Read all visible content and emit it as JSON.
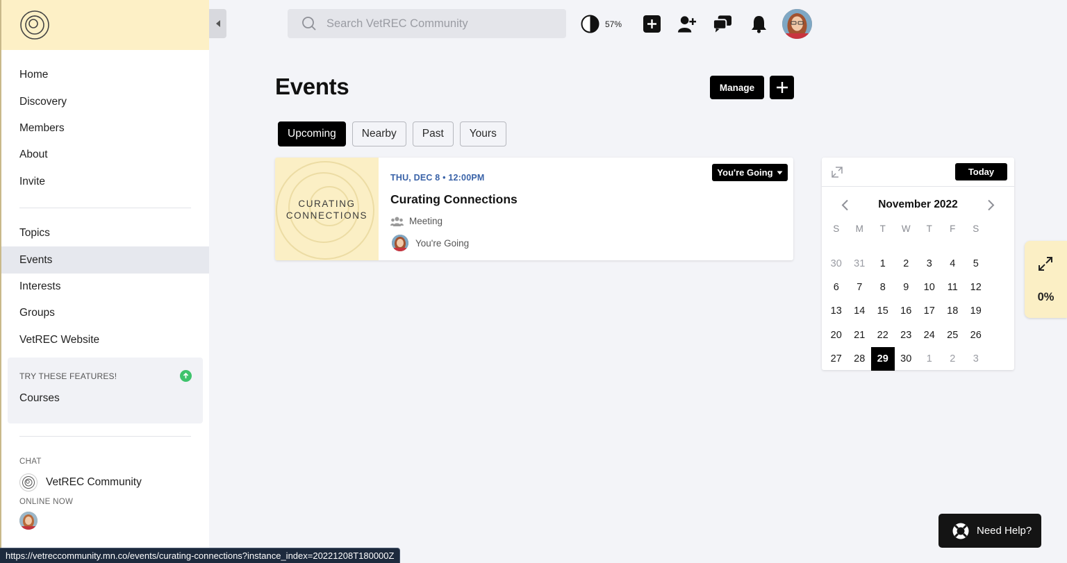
{
  "sidebar": {
    "nav_primary": [
      {
        "label": "Home"
      },
      {
        "label": "Discovery"
      },
      {
        "label": "Members"
      },
      {
        "label": "About"
      },
      {
        "label": "Invite"
      }
    ],
    "nav_secondary": [
      {
        "label": "Topics"
      },
      {
        "label": "Events",
        "active": true
      },
      {
        "label": "Interests"
      },
      {
        "label": "Groups"
      },
      {
        "label": "VetREC Website"
      }
    ],
    "features": {
      "title": "TRY THESE FEATURES!",
      "item": "Courses"
    },
    "chat_label": "CHAT",
    "chat_item": "VetREC Community",
    "online_label": "ONLINE NOW"
  },
  "topbar": {
    "search_placeholder": "Search VetREC Community",
    "contrast_pct": "57%"
  },
  "main": {
    "title": "Events",
    "manage_label": "Manage",
    "tabs": [
      {
        "label": "Upcoming",
        "active": true
      },
      {
        "label": "Nearby"
      },
      {
        "label": "Past"
      },
      {
        "label": "Yours"
      }
    ],
    "event": {
      "thumb_line1": "CURATING",
      "thumb_line2": "CONNECTIONS",
      "date": "THU, DEC 8 • 12:00PM",
      "title": "Curating Connections",
      "type": "Meeting",
      "attendee_status": "You're Going",
      "rsvp_label": "You're Going"
    }
  },
  "calendar": {
    "today_label": "Today",
    "month": "November 2022",
    "weekdays": [
      "S",
      "M",
      "T",
      "W",
      "T",
      "F",
      "S"
    ],
    "weeks": [
      [
        "30",
        "31",
        "1",
        "2",
        "3",
        "4",
        "5"
      ],
      [
        "6",
        "7",
        "8",
        "9",
        "10",
        "11",
        "12"
      ],
      [
        "13",
        "14",
        "15",
        "16",
        "17",
        "18",
        "19"
      ],
      [
        "20",
        "21",
        "22",
        "23",
        "24",
        "25",
        "26"
      ],
      [
        "27",
        "28",
        "29",
        "30",
        "1",
        "2",
        "3"
      ]
    ],
    "other_month_cells": [
      "0-0",
      "0-1",
      "4-4",
      "4-5",
      "4-6"
    ],
    "selected_cell": "4-2"
  },
  "progress_widget": {
    "pct": "0%"
  },
  "help": {
    "label": "Need Help?"
  },
  "status_url": "https://vetreccommunity.mn.co/events/curating-connections?instance_index=20221208T180000Z",
  "colors": {
    "accent_yellow": "#fdf0c6",
    "date_blue": "#3a63a8",
    "upload_green": "#3ec36c"
  }
}
